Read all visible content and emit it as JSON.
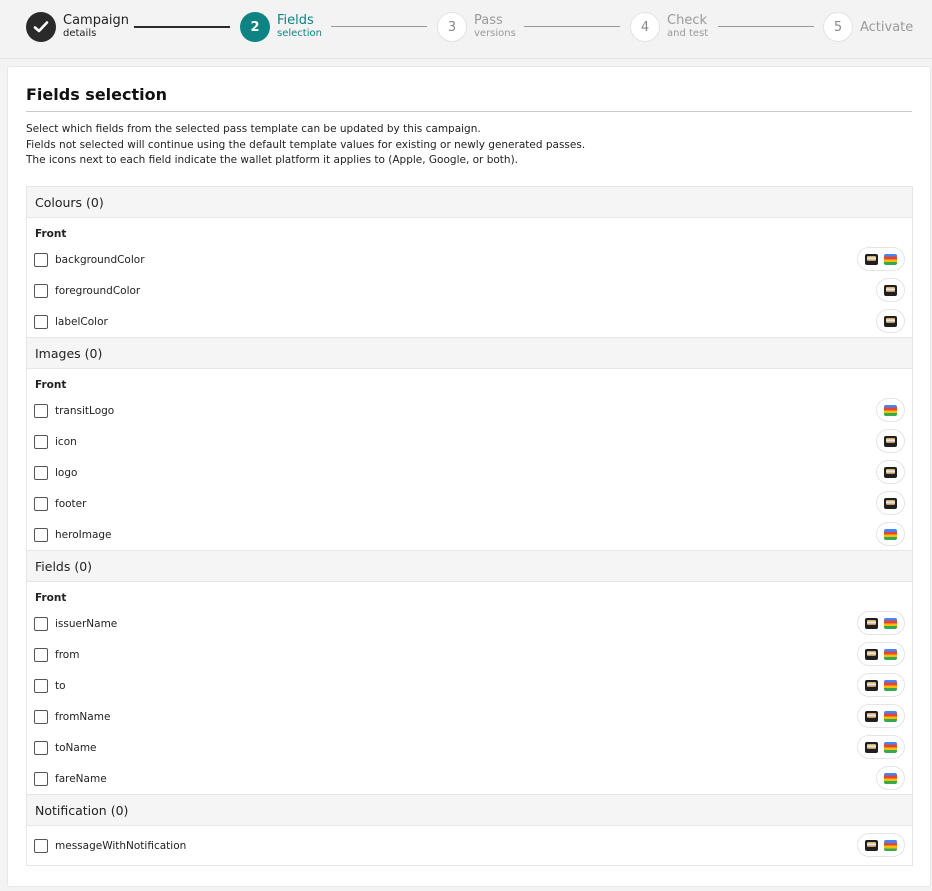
{
  "stepper": [
    {
      "number": "",
      "title": "Campaign",
      "subtitle": "details",
      "state": "done"
    },
    {
      "number": "2",
      "title": "Fields",
      "subtitle": "selection",
      "state": "active"
    },
    {
      "number": "3",
      "title": "Pass",
      "subtitle": "versions",
      "state": "todo"
    },
    {
      "number": "4",
      "title": "Check",
      "subtitle": "and test",
      "state": "todo"
    },
    {
      "number": "5",
      "title": "Activate",
      "subtitle": "",
      "state": "todo"
    }
  ],
  "page": {
    "title": "Fields selection",
    "description": [
      "Select which fields from the selected pass template can be updated by this campaign.",
      "Fields not selected will continue using the default template values for existing or newly generated passes.",
      "The icons next to each field indicate the wallet platform it applies to (Apple, Google, or both)."
    ]
  },
  "sections": [
    {
      "title": "Colours (0)",
      "group": "Front",
      "fields": [
        {
          "name": "backgroundColor",
          "platforms": [
            "apple",
            "google"
          ]
        },
        {
          "name": "foregroundColor",
          "platforms": [
            "apple"
          ]
        },
        {
          "name": "labelColor",
          "platforms": [
            "apple"
          ]
        }
      ]
    },
    {
      "title": "Images (0)",
      "group": "Front",
      "fields": [
        {
          "name": "transitLogo",
          "platforms": [
            "google"
          ]
        },
        {
          "name": "icon",
          "platforms": [
            "apple"
          ]
        },
        {
          "name": "logo",
          "platforms": [
            "apple"
          ]
        },
        {
          "name": "footer",
          "platforms": [
            "apple"
          ]
        },
        {
          "name": "heroImage",
          "platforms": [
            "google"
          ]
        }
      ]
    },
    {
      "title": "Fields (0)",
      "group": "Front",
      "fields": [
        {
          "name": "issuerName",
          "platforms": [
            "apple",
            "google"
          ]
        },
        {
          "name": "from",
          "platforms": [
            "apple",
            "google"
          ]
        },
        {
          "name": "to",
          "platforms": [
            "apple",
            "google"
          ]
        },
        {
          "name": "fromName",
          "platforms": [
            "apple",
            "google"
          ]
        },
        {
          "name": "toName",
          "platforms": [
            "apple",
            "google"
          ]
        },
        {
          "name": "fareName",
          "platforms": [
            "google"
          ]
        }
      ]
    },
    {
      "title": "Notification (0)",
      "group": "",
      "fields": [
        {
          "name": "messageWithNotification",
          "platforms": [
            "apple",
            "google"
          ]
        }
      ]
    }
  ],
  "colors": {
    "accent": "#0d8383",
    "done": "#2a2a2a"
  }
}
